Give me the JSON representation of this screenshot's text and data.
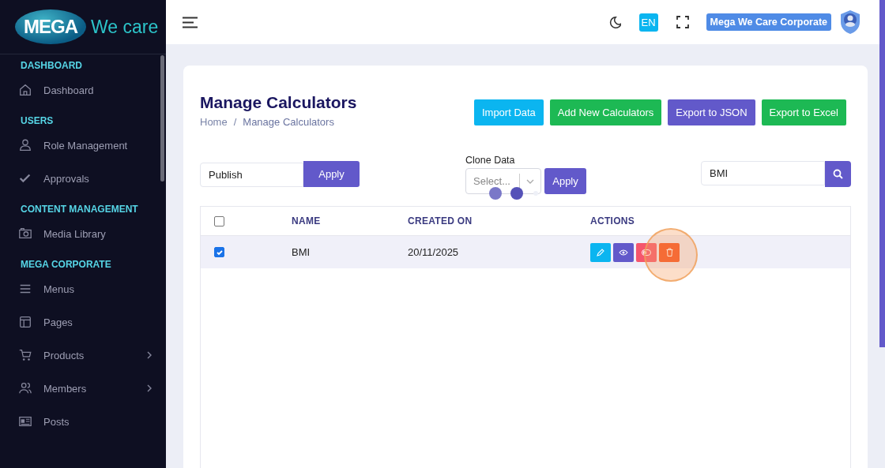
{
  "logo": {
    "badge": "MEGA",
    "text": "We care"
  },
  "sidebar": {
    "sections": [
      {
        "title": "DASHBOARD",
        "items": [
          {
            "label": "Dashboard",
            "expandable": false
          }
        ]
      },
      {
        "title": "USERS",
        "items": [
          {
            "label": "Role Management",
            "expandable": false
          },
          {
            "label": "Approvals",
            "expandable": false
          }
        ]
      },
      {
        "title": "CONTENT MANAGEMENT",
        "items": [
          {
            "label": "Media Library",
            "expandable": false
          }
        ]
      },
      {
        "title": "MEGA CORPORATE",
        "items": [
          {
            "label": "Menus",
            "expandable": false
          },
          {
            "label": "Pages",
            "expandable": false
          },
          {
            "label": "Products",
            "expandable": true
          },
          {
            "label": "Members",
            "expandable": true
          },
          {
            "label": "Posts",
            "expandable": false
          }
        ]
      }
    ]
  },
  "topbar": {
    "language": "EN",
    "account": "Mega We Care Corporate"
  },
  "page": {
    "title": "Manage Calculators",
    "breadcrumb": [
      "Home",
      "/",
      "Manage Calculators"
    ],
    "actions": [
      {
        "label": "Import Data",
        "color": "#0bb5f0"
      },
      {
        "label": "Add New Calculators",
        "color": "#1db954"
      },
      {
        "label": "Export to JSON",
        "color": "#6259ca"
      },
      {
        "label": "Export to Excel",
        "color": "#1db954"
      }
    ],
    "bulk": {
      "value": "Publish",
      "apply": "Apply"
    },
    "clone": {
      "label": "Clone Data",
      "placeholder": "Select...",
      "apply": "Apply",
      "loading": true
    },
    "search": {
      "value": "BMI"
    },
    "table": {
      "select_all": false,
      "columns": [
        "NAME",
        "CREATED ON",
        "ACTIONS"
      ],
      "rows": [
        {
          "checked": true,
          "cells": [
            "BMI",
            "20/11/2025"
          ]
        }
      ]
    }
  }
}
